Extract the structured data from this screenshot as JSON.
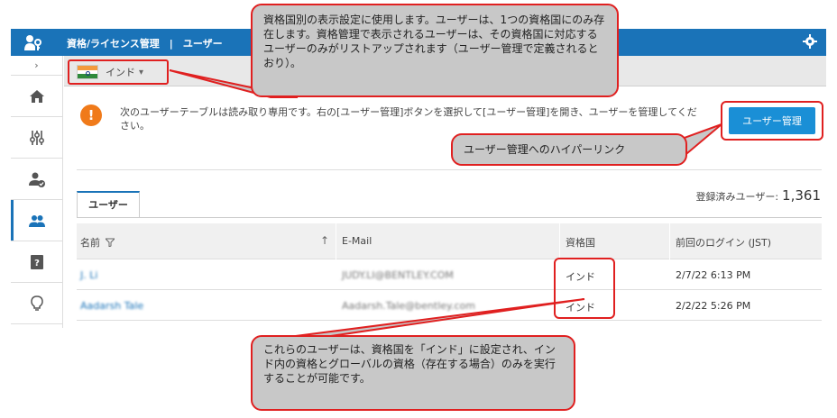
{
  "header": {
    "title": "資格/ライセンス管理　|　ユーザー"
  },
  "country": {
    "selected": "インド"
  },
  "notice": {
    "icon_text": "!",
    "text": "次のユーザーテーブルは読み取り専用です。右の[ユーザー管理]ボタンを選択して[ユーザー管理]を開き、ユーザーを管理してください。"
  },
  "actions": {
    "user_management_label": "ユーザー管理"
  },
  "tabs": [
    {
      "label": "ユーザー"
    }
  ],
  "registered": {
    "label": "登録済みユーザー:",
    "count": "1,361"
  },
  "table": {
    "columns": [
      "名前",
      "E-Mail",
      "資格国",
      "前回のログイン (JST)"
    ],
    "rows": [
      {
        "name": "J. Li",
        "email": "JUDY.LI@BENTLEY.COM",
        "country": "インド",
        "last_login": "2/7/22 6:13 PM"
      },
      {
        "name": "Aadarsh Tale",
        "email": "Aadarsh.Tale@bentley.com",
        "country": "インド",
        "last_login": "2/2/22 5:26 PM"
      }
    ]
  },
  "callouts": {
    "country_setting": "資格国別の表示設定に使用します。ユーザーは、1つの資格国にのみ存在します。資格管理で表示されるユーザーは、その資格国に対応するユーザーのみがリストアップされます（ユーザー管理で定義されるとおり）。",
    "hyperlink": "ユーザー管理へのハイパーリンク",
    "users_note": "これらのユーザーは、資格国を「インド」に設定され、インド内の資格とグローバルの資格（存在する場合）のみを実行することが可能です。"
  },
  "icons": {
    "logo": "key-person-icon",
    "gear": "gear-icon",
    "nav": [
      "home-icon",
      "sliders-icon",
      "user-check-icon",
      "users-icon",
      "help-book-icon",
      "lightbulb-icon"
    ]
  },
  "colors": {
    "brand": "#1a73b8",
    "button": "#1a8fd6",
    "warning": "#f07a1a",
    "callout_border": "#e02020"
  }
}
